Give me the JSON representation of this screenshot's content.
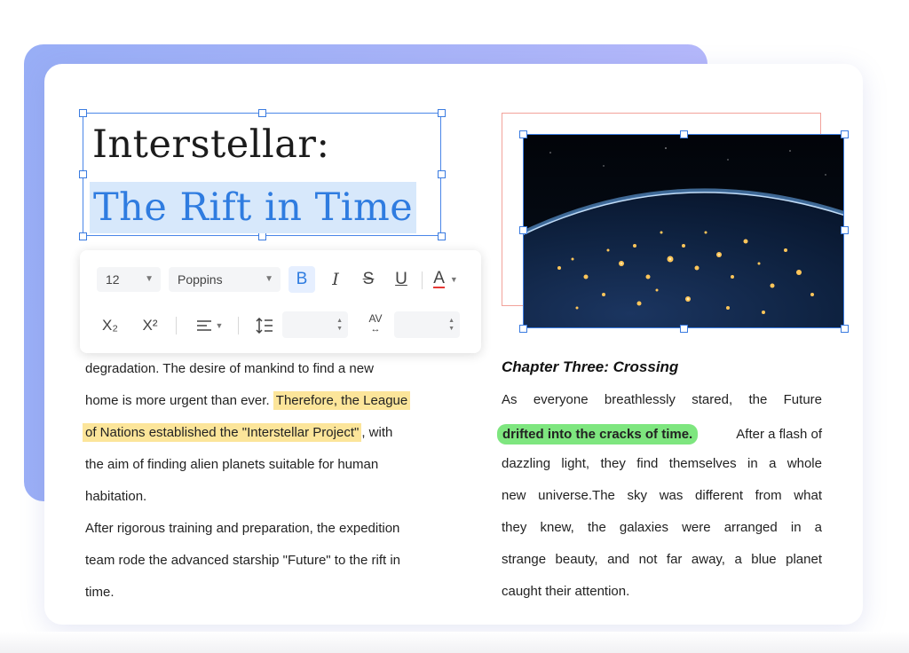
{
  "title": {
    "line1": "Interstellar:",
    "line2": "The Rift in Time"
  },
  "toolbar": {
    "font_size": "12",
    "font_family": "Poppins",
    "bold_glyph": "B",
    "italic_glyph": "I",
    "strike_glyph": "S",
    "underline_glyph": "U",
    "font_color_glyph": "A",
    "subscript_glyph": "X₂",
    "superscript_glyph": "X²",
    "spacing_glyph": "AV"
  },
  "left_column": {
    "lines": [
      {
        "text": "degradation. The desire of mankind to find a new"
      },
      {
        "pre": "home is more urgent than ever. ",
        "highlight": "Therefore, the League"
      },
      {
        "highlight": "of Nations established the \"Interstellar Project\"",
        "post": ", with"
      },
      {
        "text": "the aim of finding alien planets suitable for human"
      },
      {
        "text": "habitation."
      },
      {
        "text": "After rigorous training and preparation, the expedition"
      },
      {
        "text": "team rode the advanced starship \"Future\" to the rift in"
      },
      {
        "text": "time."
      }
    ]
  },
  "right_column": {
    "chapter_title": "Chapter Three: Crossing",
    "line1": "As everyone breathlessly stared, the Future",
    "line2_highlight": "drifted into the cracks of time.",
    "line2_post": "After a flash of",
    "line3": "dazzling light, they find themselves in a whole",
    "line4": "new universe.The sky was different from what",
    "line5": "they knew, the galaxies were arranged in a",
    "line6": "strange beauty, and not far away, a blue planet",
    "line7": "caught their attention."
  },
  "colors": {
    "accent": "#2f7ce0",
    "selection": "#3a7be0",
    "highlight_yellow": "#fce59a",
    "highlight_green": "#7ee67f",
    "image_outline": "#f2a29a",
    "font_color_underline": "#e53935"
  },
  "icons": [
    "chevron-down-icon",
    "bold-icon",
    "italic-icon",
    "strikethrough-icon",
    "underline-icon",
    "font-color-icon",
    "subscript-icon",
    "superscript-icon",
    "align-left-icon",
    "line-spacing-icon",
    "letter-spacing-icon",
    "stepper-icon"
  ]
}
